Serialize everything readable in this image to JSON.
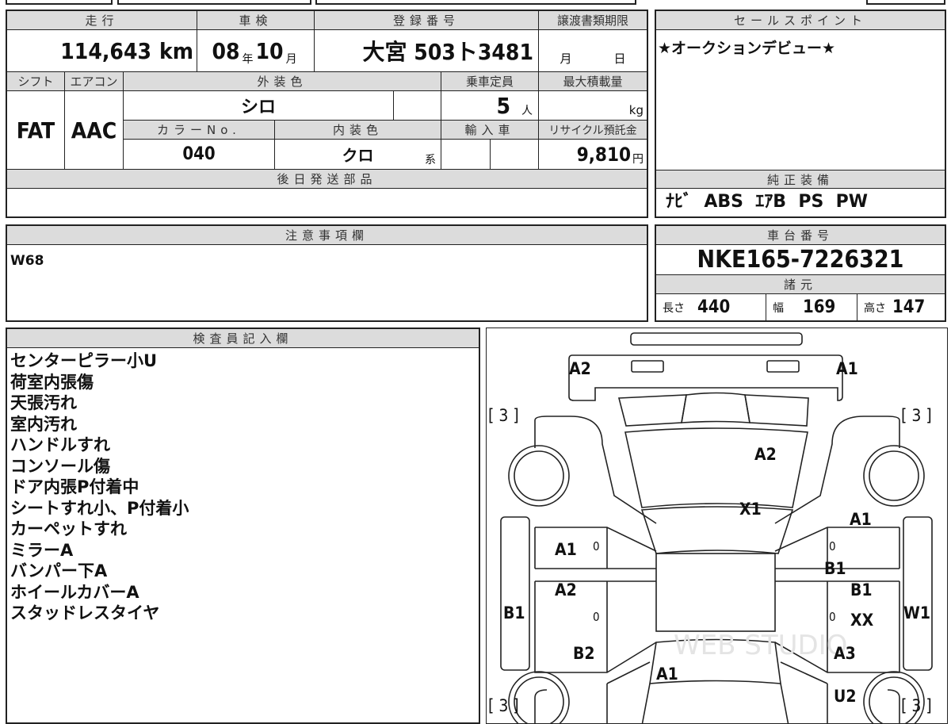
{
  "main_table": {
    "mileage_label": "走行",
    "mileage_value": "114,643",
    "mileage_unit": "km",
    "inspection_label": "車検",
    "inspection_year": "08",
    "inspection_year_unit": "年",
    "inspection_month": "10",
    "inspection_month_unit": "月",
    "registration_label": "登録番号",
    "registration_value": "大宮 503ト3481",
    "transfer_deadline_label": "譲渡書類期限",
    "transfer_month_unit": "月",
    "transfer_day_unit": "日",
    "shift_label": "シフト",
    "shift_value": "FAT",
    "aircon_label": "エアコン",
    "aircon_value": "AAC",
    "exterior_color_label": "外装色",
    "exterior_color_value": "シロ",
    "capacity_label": "乗車定員",
    "capacity_value": "5",
    "capacity_unit": "人",
    "max_load_label": "最大積載量",
    "max_load_unit": "kg",
    "color_no_label": "カラーNo.",
    "color_no_value": "040",
    "interior_color_label": "内装色",
    "interior_color_value": "クロ",
    "interior_color_unit": "系",
    "import_label": "輸入車",
    "recycle_label": "リサイクル預託金",
    "recycle_value": "9,810",
    "recycle_unit": "円",
    "later_parts_label": "後日発送部品"
  },
  "sales_point": {
    "label": "セールスポイント",
    "value": "★オークションデビュー★"
  },
  "equipment": {
    "label": "純正装備",
    "value": "ﾅﾋﾞ  ABS  ｴｱB  PS  PW"
  },
  "notes": {
    "label": "注意事項欄",
    "value": "W68"
  },
  "chassis": {
    "label": "車台番号",
    "value": "NKE165-7226321",
    "specs_label": "諸元",
    "length_label": "長さ",
    "length_value": "440",
    "width_label": "幅",
    "width_value": "169",
    "height_label": "高さ",
    "height_value": "147"
  },
  "inspector": {
    "label": "検査員記入欄",
    "lines": [
      "センターピラー小U",
      "荷室内張傷",
      "天張汚れ",
      "室内汚れ",
      "ハンドルすれ",
      "コンソール傷",
      "ドア内張P付着中",
      "シートすれ小、P付着小",
      "カーペットすれ",
      "ミラーA",
      "バンパー下A",
      "ホイールカバーA",
      "スタッドレスタイヤ"
    ]
  },
  "diagram": {
    "watermark": "WEB STUDIO",
    "marks": {
      "front_left": "A2",
      "front_right": "A1",
      "tire_fl": "[ 3 ]",
      "tire_fr": "[ 3 ]",
      "tire_rl": "[ 3 ]",
      "tire_rr": "[ 3 ]",
      "hood": "A2",
      "windshield": "X1",
      "door_fr": "A1",
      "door_fl": "A1",
      "door_rl": "A2",
      "sill_left": "B1",
      "pillar_right": "B1",
      "door_rr": "B1",
      "sill_right": "W1",
      "door_rr_2": "XX",
      "quarter_left": "B2",
      "quarter_right": "A3",
      "trunk": "A1",
      "rear_right": "U2",
      "zero": "0"
    }
  }
}
